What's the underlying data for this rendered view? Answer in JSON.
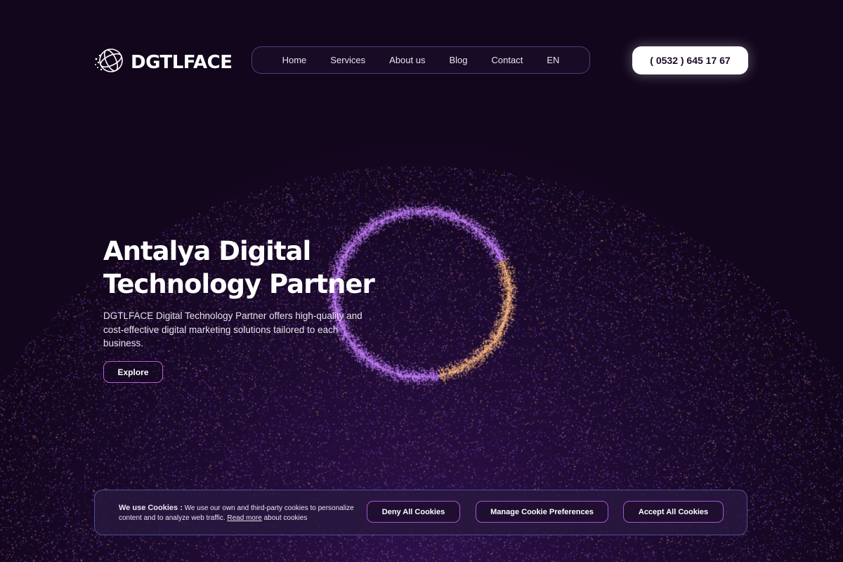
{
  "brand": {
    "name": "DGTLFACE",
    "icon": "globe-network-icon"
  },
  "nav": {
    "items": [
      "Home",
      "Services",
      "About us",
      "Blog",
      "Contact",
      "EN"
    ]
  },
  "contact": {
    "phone": "( 0532 ) 645 17 67"
  },
  "hero": {
    "title_line1": "Antalya Digital",
    "title_line2": "Technology Partner",
    "description": "DGTLFACE Digital Technology Partner offers high-quality and cost-effective digital marketing solutions tailored to each business.",
    "cta": "Explore"
  },
  "cookie": {
    "heading": "We use Cookies :",
    "text_before_link": "We use our own and third-party cookies to personalize content and to analyze web traffic.",
    "link": "Read more",
    "text_after_link": "about cookies",
    "deny": "Deny All Cookies",
    "manage": "Manage Cookie Preferences",
    "accept": "Accept All Cookies"
  },
  "colors": {
    "background": "#12061c",
    "accent_purple": "#a356cc",
    "particle_purple": "#8a4fd8",
    "particle_orange": "#f0a070"
  }
}
